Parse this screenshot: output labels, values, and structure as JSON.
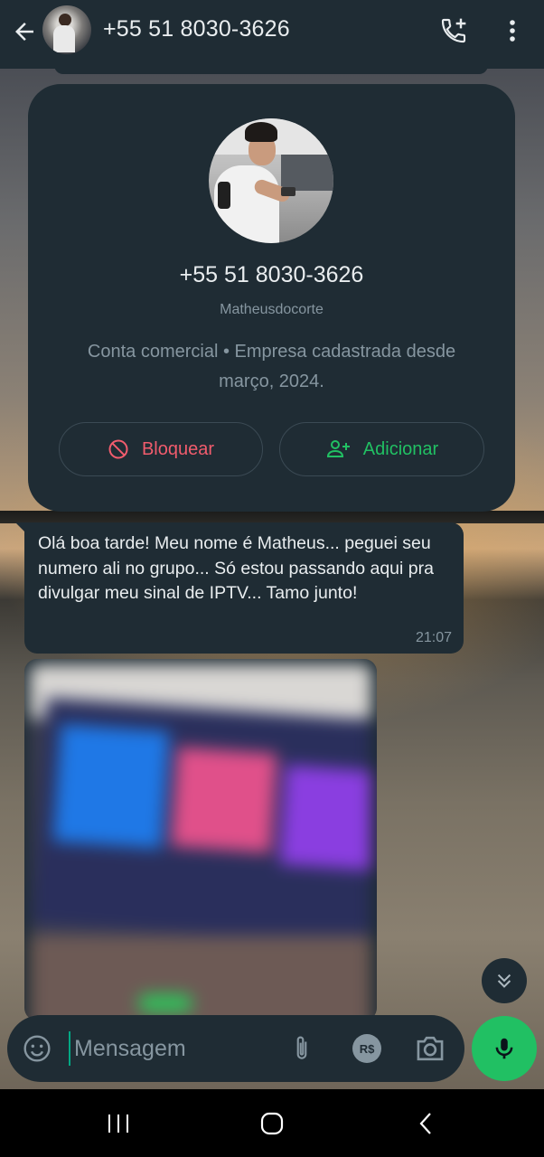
{
  "header": {
    "title": "+55 51 8030-3626",
    "back_icon": "arrow-left-icon",
    "call_icon": "add-call-icon",
    "menu_icon": "more-vert-icon"
  },
  "business_card": {
    "name": "+55 51 8030-3626",
    "subtitle": "Matheusdocorte",
    "description": "Conta comercial • Empresa cadastrada desde março, 2024.",
    "block_label": "Bloquear",
    "add_label": "Adicionar"
  },
  "message": {
    "text": "Olá boa tarde! Meu nome é Matheus... peguei seu numero ali no grupo... Só estou passando aqui pra divulgar meu sinal de IPTV... Tamo junto!",
    "time": "21:07"
  },
  "composer": {
    "placeholder": "Mensagem",
    "pay_label": "R$"
  },
  "colors": {
    "accent_green": "#21c063",
    "danger_red": "#f15c6d",
    "bubble_bg": "#1f2c34",
    "header_bg": "#1f2c34",
    "text_primary": "#e9edef",
    "text_secondary": "#8696a0"
  }
}
